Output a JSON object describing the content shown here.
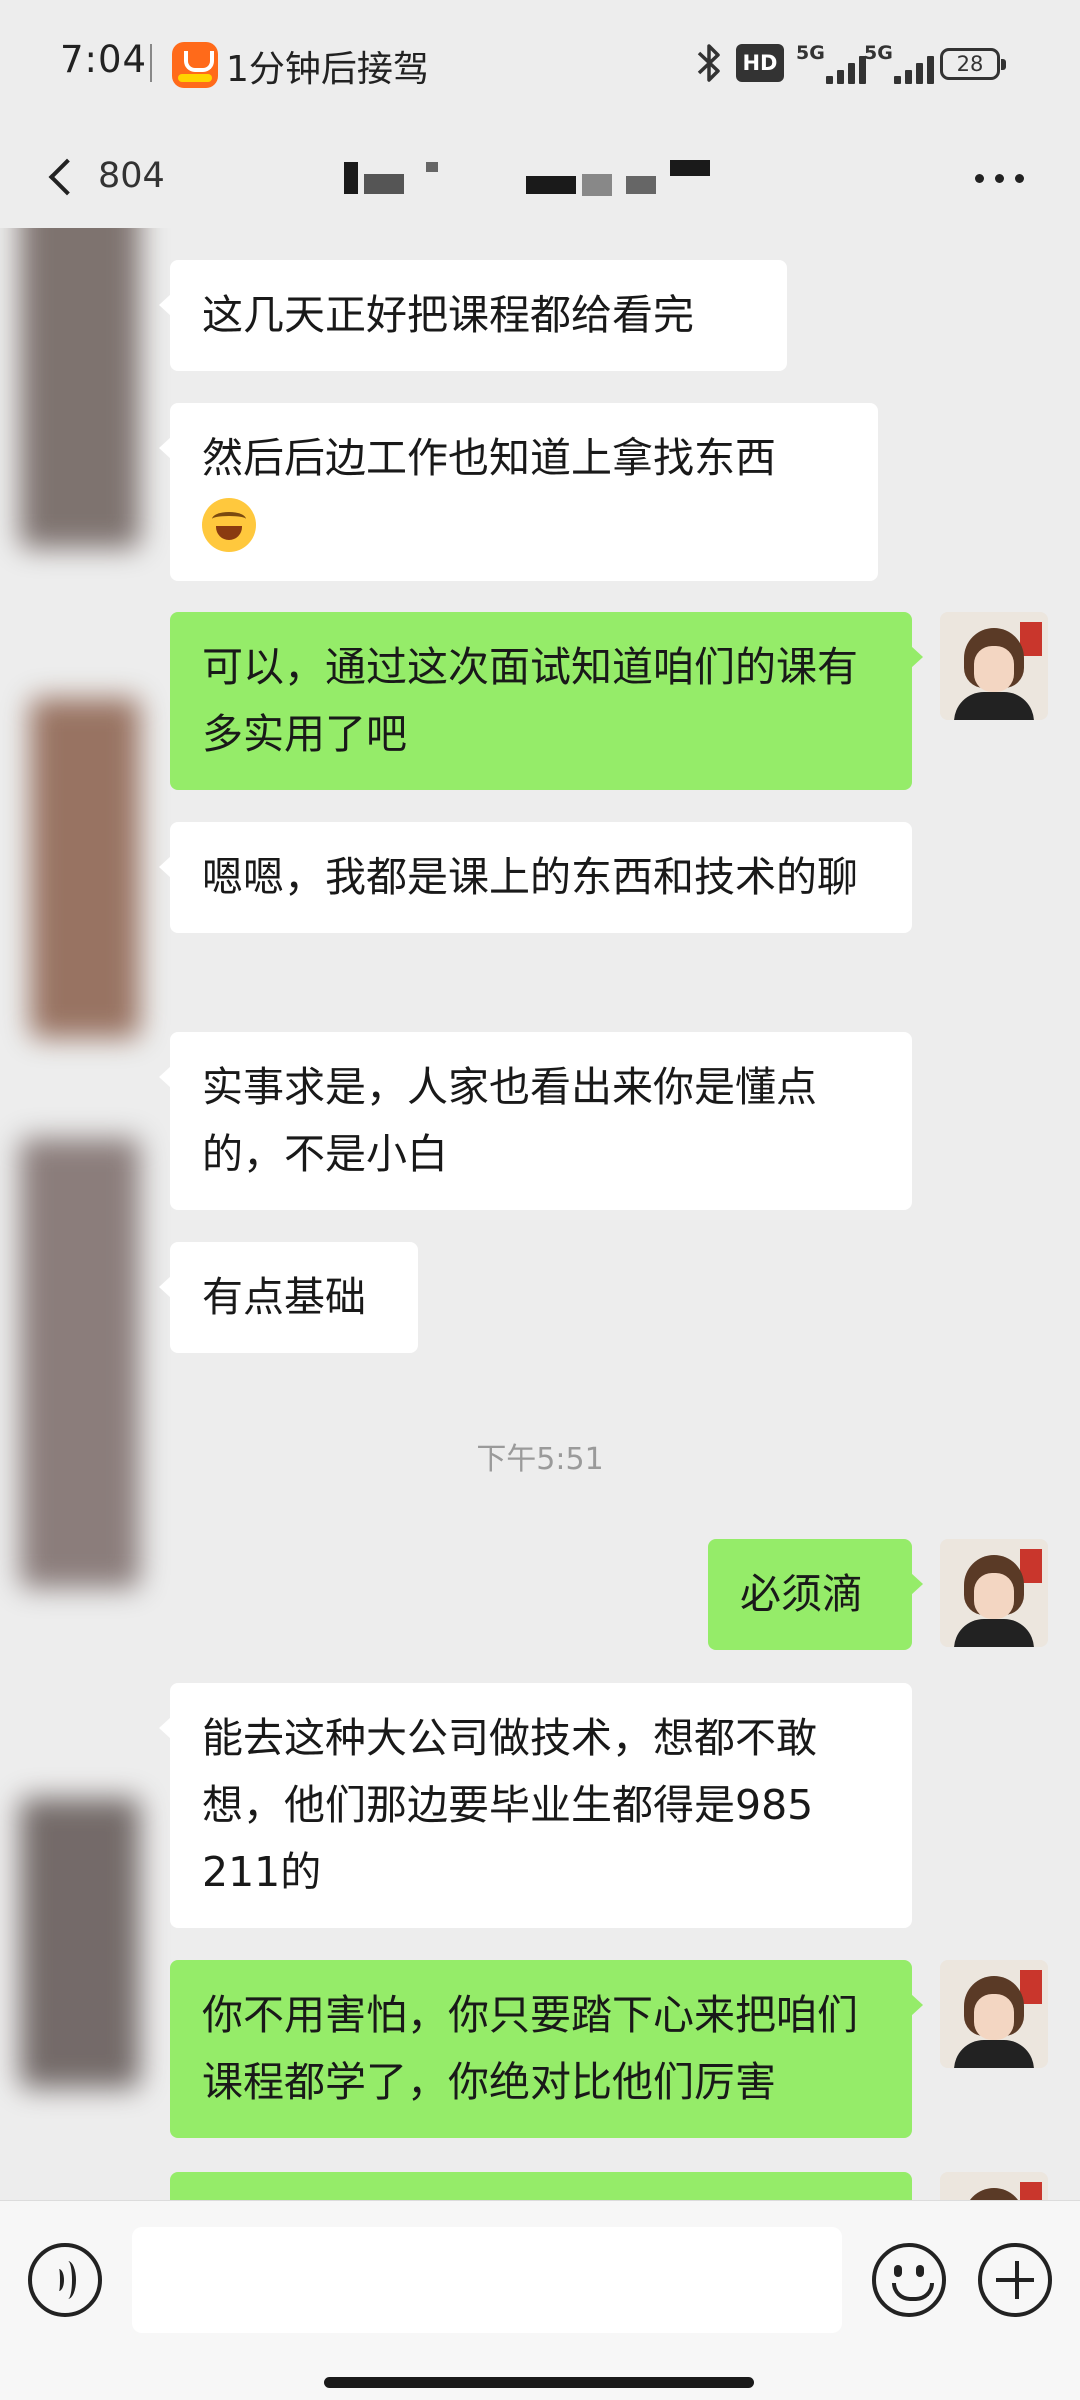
{
  "status_bar": {
    "time": "7:04",
    "notification_text": "1分钟后接驾",
    "hd_label": "HD",
    "network_1": "5G",
    "network_2": "5G",
    "battery": "28"
  },
  "title_bar": {
    "unread_count": "804",
    "more_icon": "more-dots-icon"
  },
  "messages": [
    {
      "side": "left",
      "text": "这几天正好把课程都给看完"
    },
    {
      "side": "left",
      "text": "然后后边工作也知道上拿找东西",
      "emoji": "laughing-emoji"
    },
    {
      "side": "right",
      "text": "可以，通过这次面试知道咱们的课有多实用了吧"
    },
    {
      "side": "left",
      "text": "嗯嗯，我都是课上的东西和技术的聊"
    },
    {
      "side": "left",
      "text": "实事求是，人家也看出来你是懂点的，不是小白"
    },
    {
      "side": "left",
      "text": "有点基础"
    },
    {
      "side": "right",
      "text": "必须滴"
    },
    {
      "side": "left",
      "text": "能去这种大公司做技术，想都不敢想，他们那边要毕业生都得是985 211的"
    },
    {
      "side": "right",
      "text": "你不用害怕，你只要踏下心来把咱们课程都学了，你绝对比他们厉害"
    }
  ],
  "timestamp": "下午5:51",
  "input_bar": {
    "voice_icon": "voice-icon",
    "input_value": "",
    "emoji_icon": "smiley-icon",
    "plus_icon": "plus-icon"
  },
  "colors": {
    "background": "#ededed",
    "bubble_self": "#95ec69",
    "bubble_other": "#ffffff"
  }
}
